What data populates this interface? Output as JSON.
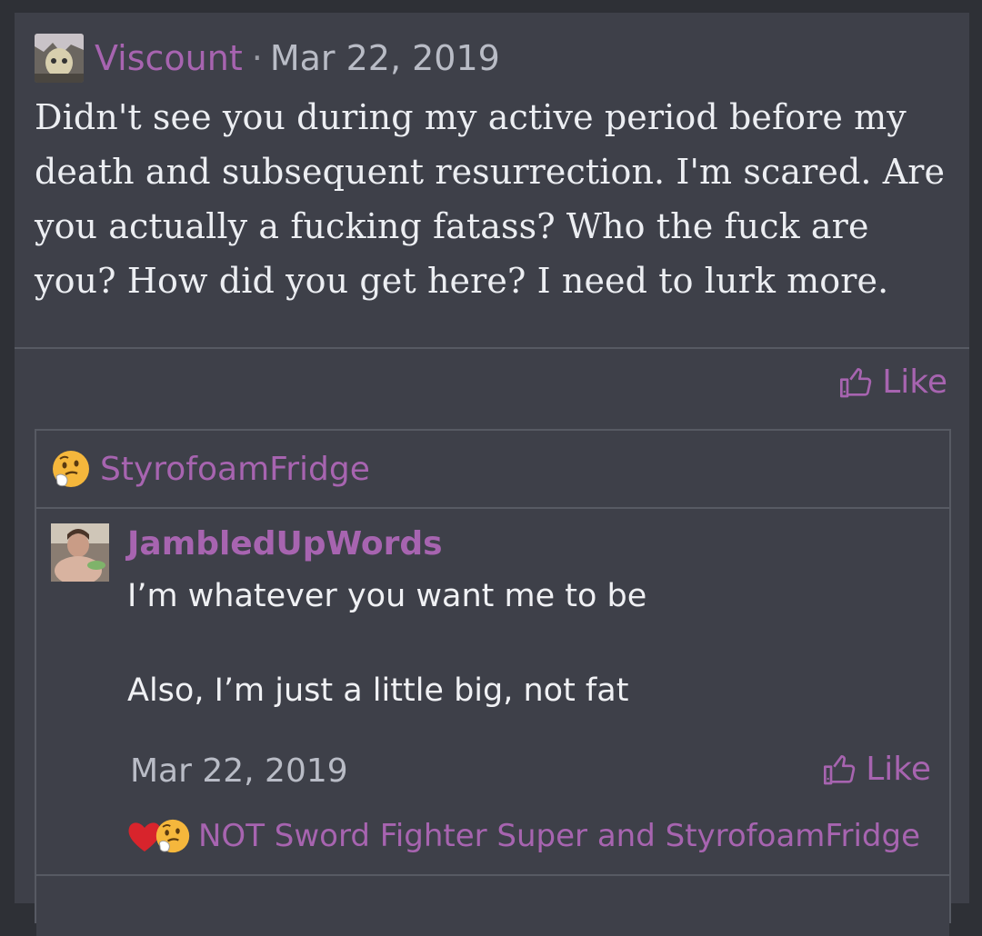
{
  "post": {
    "username": "Viscount",
    "separator": "·",
    "date": "Mar 22, 2019",
    "body": "Didn't see you during my active period before my death and subsequent resurrection. I'm scared. Are you actually a fucking fatass? Who the fuck are you? How did you get here? I need to lurk more.",
    "like_label": "Like"
  },
  "quote": {
    "reactor_name": "StyrofoamFridge",
    "inner": {
      "username": "JambledUpWords",
      "line1": "I’m whatever you want me to be",
      "line2": "Also, I’m just a little big, not fat",
      "date": "Mar 22, 2019",
      "like_label": "Like",
      "reactions_text": "NOT Sword Fighter Super and StyrofoamFridge"
    }
  },
  "colors": {
    "accent": "#a764b0",
    "background": "#3e4049",
    "text": "#eceef2"
  },
  "icons": [
    "user-avatar",
    "thumbs-up-icon",
    "thinking-emoji-icon",
    "heart-icon"
  ]
}
